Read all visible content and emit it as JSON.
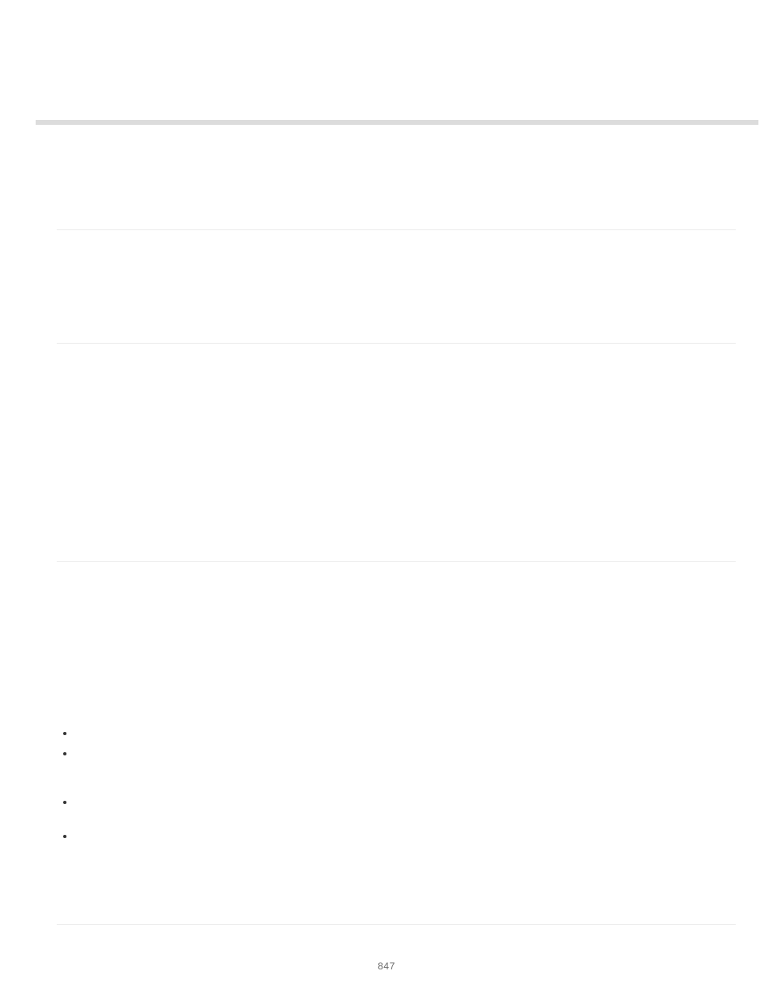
{
  "page": {
    "number": "847"
  }
}
